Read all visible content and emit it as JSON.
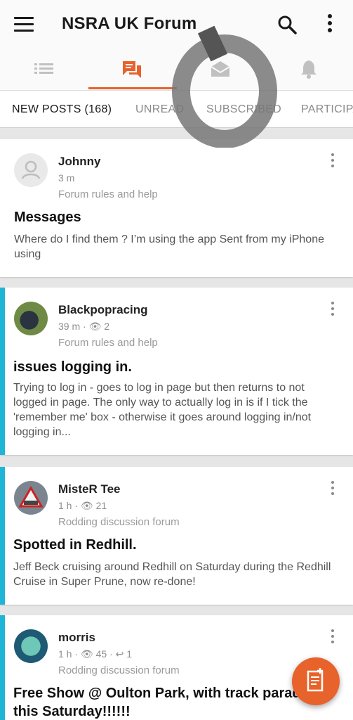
{
  "app": {
    "title": "NSRA UK Forum"
  },
  "icons": {
    "menu": "hamburger-menu-icon",
    "search": "search-icon",
    "more": "more-vertical-icon",
    "list": "list-icon",
    "chat": "chat-icon",
    "envelope": "envelope-icon",
    "bell": "bell-icon",
    "compose": "compose-icon"
  },
  "colors": {
    "accent": "#e8622c",
    "unread_marker": "#1fb5d6"
  },
  "tabs": [
    {
      "label": "NEW POSTS (168)",
      "active": true
    },
    {
      "label": "UNREAD"
    },
    {
      "label": "SUBSCRIBED"
    },
    {
      "label": "PARTICIPATED"
    }
  ],
  "posts": [
    {
      "author": "Johnny",
      "meta": "3 m",
      "forum": "Forum rules and help",
      "title": "Messages",
      "excerpt": "Where do I find them ? I’m using the app Sent from my iPhone using"
    },
    {
      "author": "Blackpopracing",
      "meta": "39 m · 👁 2",
      "forum": "Forum rules and help",
      "title": "issues logging in.",
      "excerpt": "Trying to log in - goes to log in page but then returns to not logged in page. The only way to actually log in is if I tick the 'remember me' box - otherwise it goes around logging in/not logging in..."
    },
    {
      "author": "MisteR Tee",
      "meta": "1 h · 👁 21",
      "forum": "Rodding discussion forum",
      "title": "Spotted in Redhill.",
      "excerpt": "Jeff Beck cruising around Redhill on Saturday during the Redhill Cruise in Super Prune, now re-done!"
    },
    {
      "author": "morris",
      "meta": "1 h · 👁 45 · ↩ 1",
      "forum": "Rodding discussion forum",
      "title": "Free Show @ Oulton Park, with track parade",
      "title_line2": "this Saturday!!!!!!"
    }
  ]
}
